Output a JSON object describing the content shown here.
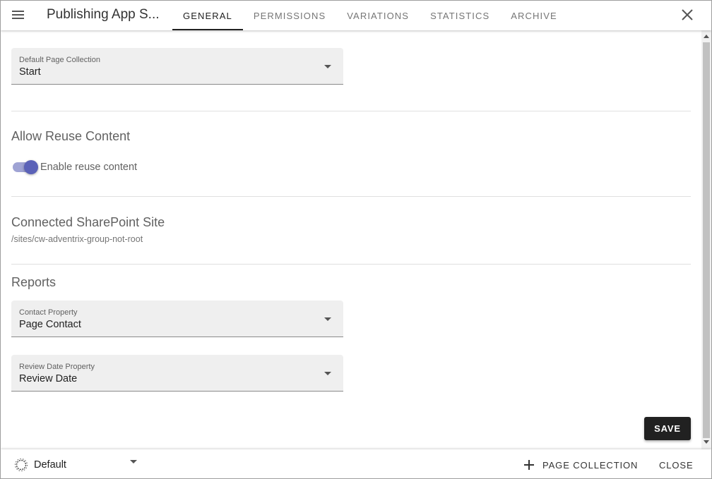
{
  "header": {
    "title": "Publishing App S...",
    "tabs": [
      {
        "label": "GENERAL",
        "active": true
      },
      {
        "label": "PERMISSIONS",
        "active": false
      },
      {
        "label": "VARIATIONS",
        "active": false
      },
      {
        "label": "STATISTICS",
        "active": false
      },
      {
        "label": "ARCHIVE",
        "active": false
      }
    ]
  },
  "general": {
    "default_page_collection": {
      "label": "Default Page Collection",
      "value": "Start"
    },
    "reuse": {
      "title": "Allow Reuse Content",
      "toggle_label": "Enable reuse content",
      "enabled": true
    },
    "sharepoint": {
      "title": "Connected SharePoint Site",
      "path": "/sites/cw-adventrix-group-not-root"
    },
    "reports": {
      "title": "Reports",
      "contact_property": {
        "label": "Contact Property",
        "value": "Page Contact"
      },
      "review_date_property": {
        "label": "Review Date Property",
        "value": "Review Date"
      }
    },
    "save_label": "SAVE"
  },
  "footer": {
    "variation_value": "Default",
    "page_collection_label": "PAGE COLLECTION",
    "close_label": "CLOSE"
  },
  "colors": {
    "accent": "#5b62b8",
    "accent_track": "#9fa3d4",
    "primary_button": "#212121"
  },
  "icons": [
    "menu-icon",
    "close-icon",
    "chevron-down-icon",
    "gear-icon",
    "plus-icon"
  ]
}
